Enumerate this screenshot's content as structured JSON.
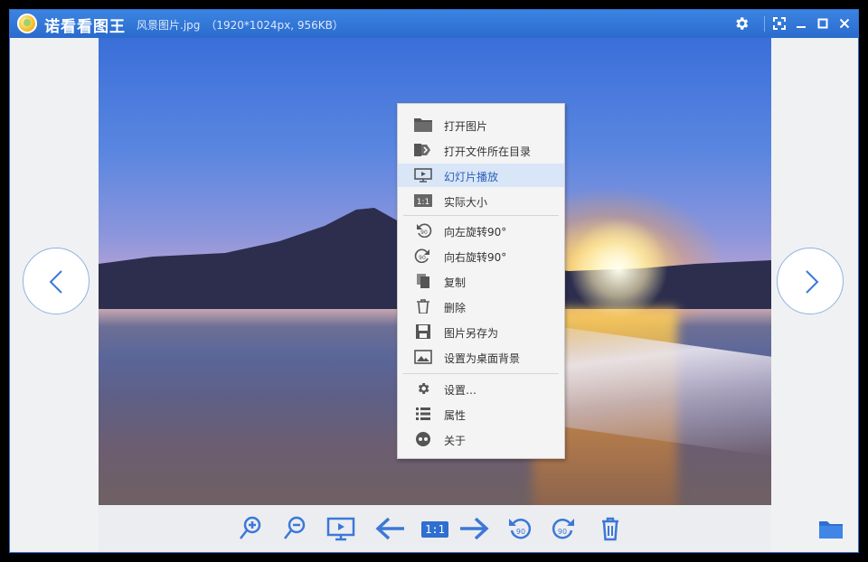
{
  "window": {
    "app_title": "诺看看图王",
    "file_name": "风景图片.jpg",
    "file_meta": "（1920*1024px, 956KB）",
    "accent": "#2f6fd0"
  },
  "titlebar_buttons": [
    "gear-icon",
    "fullscreen-icon",
    "minimize-icon",
    "maximize-icon",
    "close-icon"
  ],
  "context_menu": {
    "items": [
      {
        "label": "打开图片",
        "icon": "folder-icon"
      },
      {
        "label": "打开文件所在目录",
        "icon": "open-folder-icon"
      },
      {
        "label": "幻灯片播放",
        "icon": "slideshow-icon",
        "highlighted": true
      },
      {
        "label": "实际大小",
        "icon": "actual-size-icon",
        "badge": "1:1"
      },
      {
        "label": "向左旋转90°",
        "icon": "rotate-left-icon",
        "badge": "90"
      },
      {
        "label": "向右旋转90°",
        "icon": "rotate-right-icon",
        "badge": "90"
      },
      {
        "label": "复制",
        "icon": "copy-icon"
      },
      {
        "label": "删除",
        "icon": "trash-icon"
      },
      {
        "label": "图片另存为",
        "icon": "save-icon"
      },
      {
        "label": "设置为桌面背景",
        "icon": "wallpaper-icon"
      },
      {
        "label": "设置…",
        "icon": "gear-icon"
      },
      {
        "label": "属性",
        "icon": "properties-icon"
      },
      {
        "label": "关于",
        "icon": "about-icon"
      }
    ]
  },
  "toolbar": {
    "actual_size_label": "1:1",
    "rotate_badge": "90",
    "tools": [
      "zoom-in-icon",
      "zoom-out-icon",
      "slideshow-icon",
      "prev-arrow-icon",
      "actual-size-button",
      "next-arrow-icon",
      "rotate-left-icon",
      "rotate-right-icon",
      "trash-icon"
    ],
    "folder": "folder-icon"
  }
}
